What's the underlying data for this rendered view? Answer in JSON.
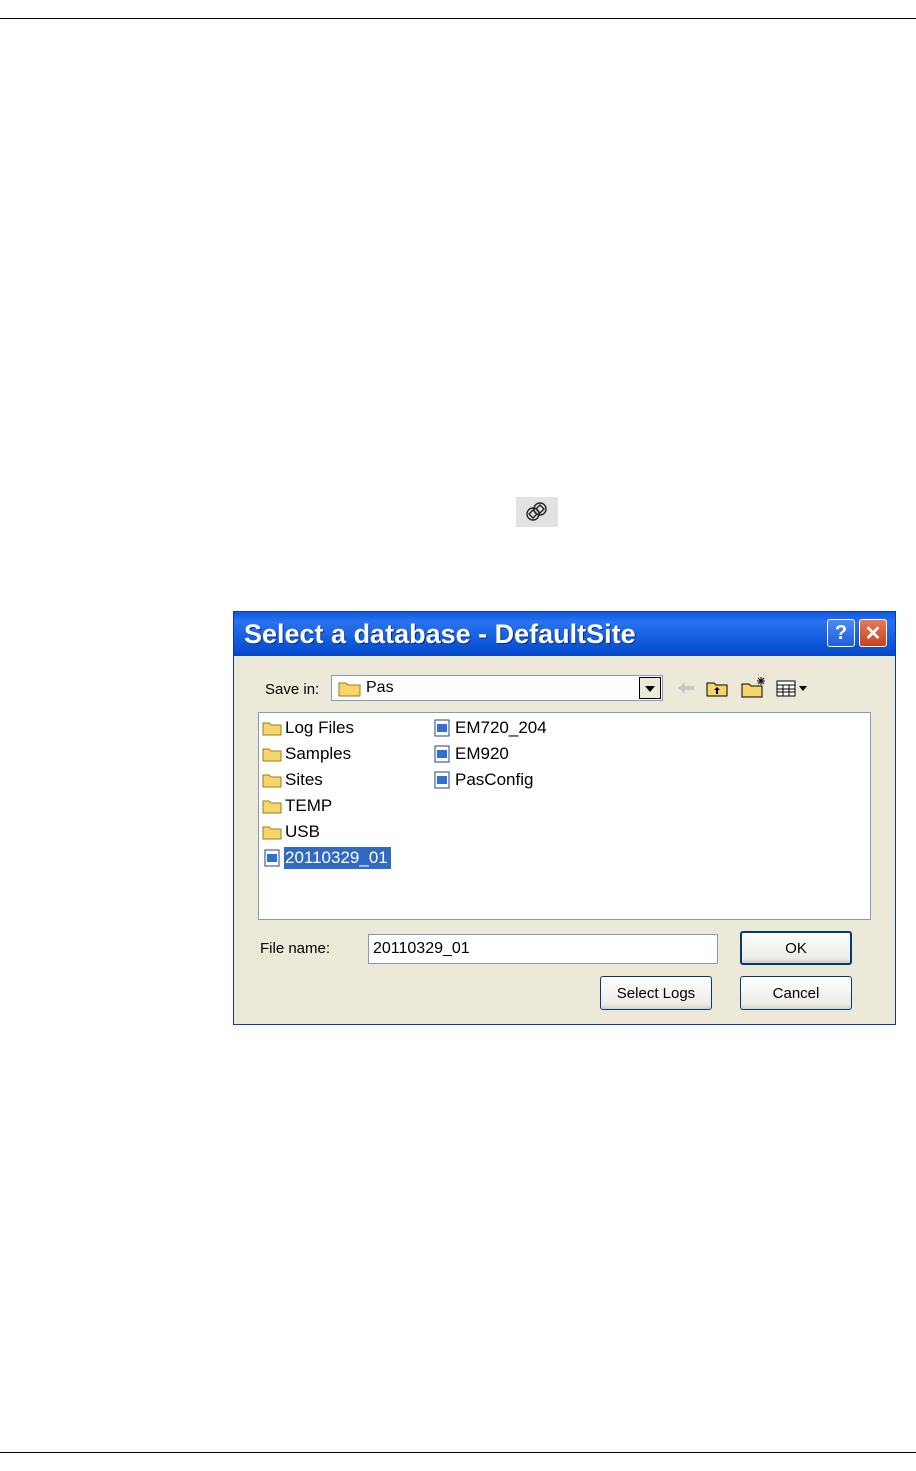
{
  "dialog": {
    "title": "Select a database - DefaultSite",
    "help_glyph": "?",
    "close_glyph": "✕",
    "save_in_label": "Save in:",
    "save_in_value": "Pas",
    "toolbar_icons": [
      "back-arrow-icon",
      "up-folder-icon",
      "new-folder-icon",
      "view-menu-icon"
    ],
    "items": [
      {
        "label": "Log Files",
        "type": "folder"
      },
      {
        "label": "Samples",
        "type": "folder"
      },
      {
        "label": "Sites",
        "type": "folder"
      },
      {
        "label": "TEMP",
        "type": "folder"
      },
      {
        "label": "USB",
        "type": "folder"
      },
      {
        "label": "20110329_01",
        "type": "database",
        "selected": true
      },
      {
        "label": "EM720_204",
        "type": "database"
      },
      {
        "label": "EM920",
        "type": "database"
      },
      {
        "label": "PasConfig",
        "type": "database"
      }
    ],
    "file_name_label": "File name:",
    "file_name_value": "20110329_01",
    "ok_label": "OK",
    "cancel_label": "Cancel",
    "select_logs_label": "Select Logs"
  },
  "colors": {
    "title_bar": "#0a53d6",
    "dialog_bg": "#ece9d8",
    "selection": "#316ac5",
    "folder": "#f6d56a"
  }
}
